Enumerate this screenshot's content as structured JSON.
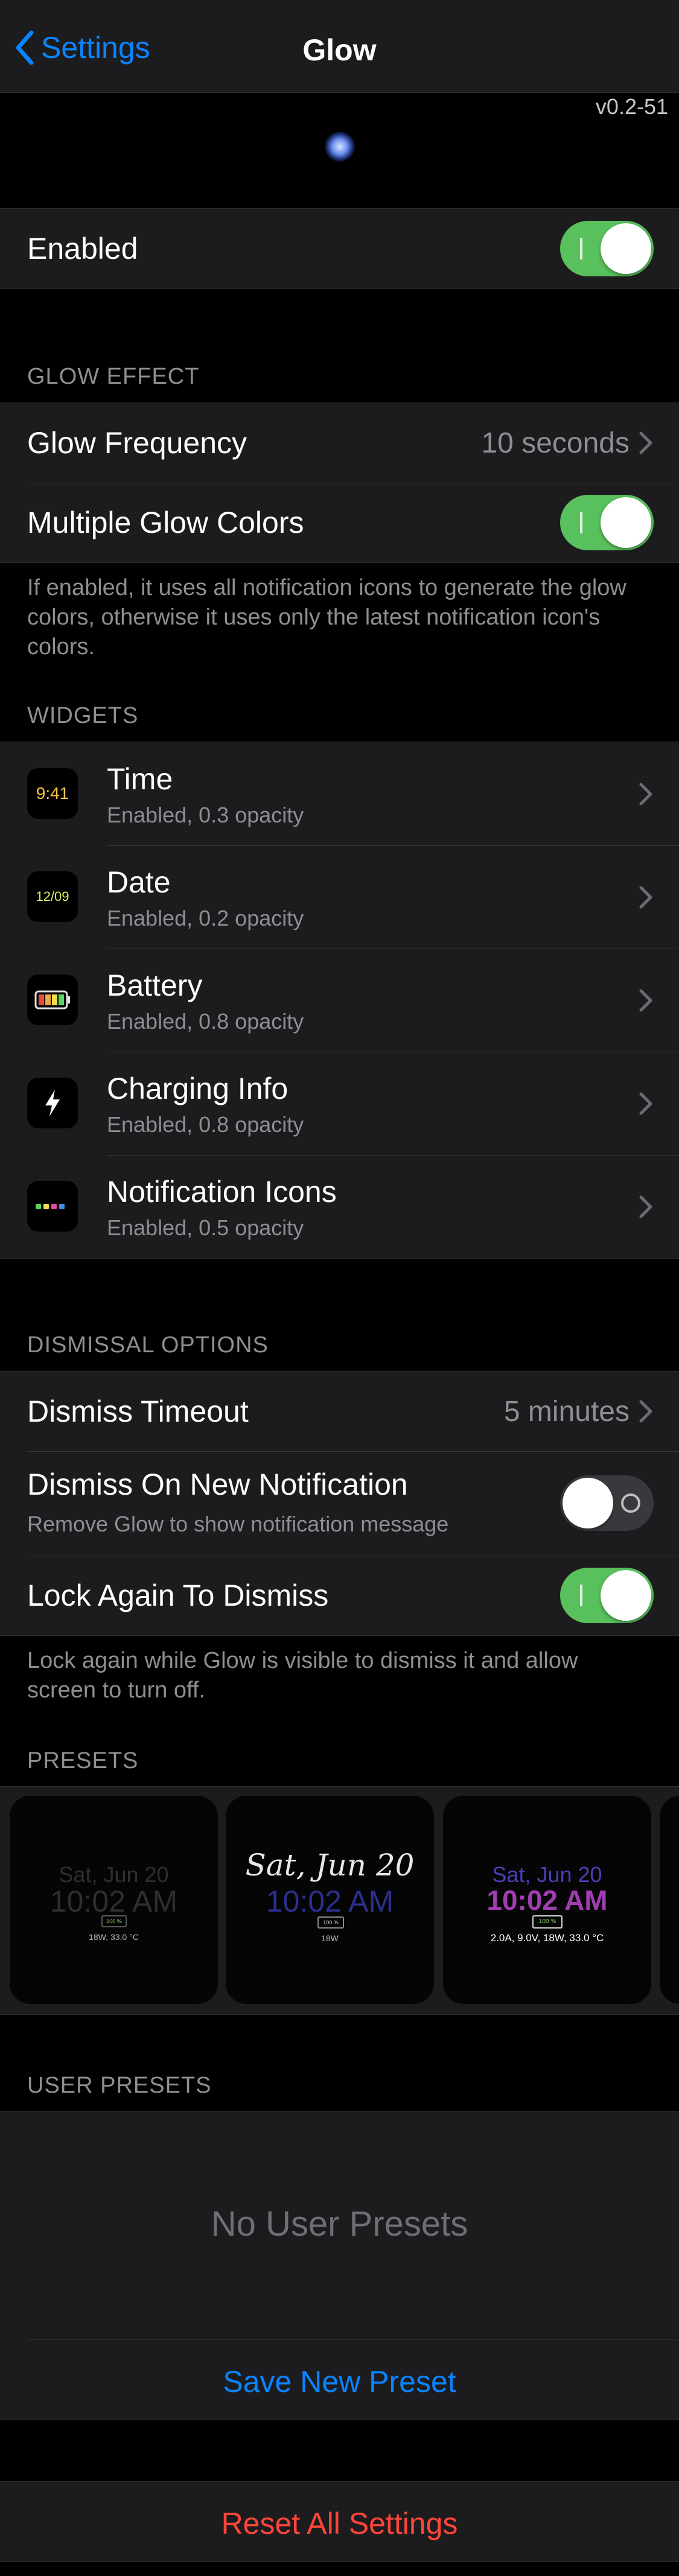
{
  "nav": {
    "back_label": "Settings",
    "title": "Glow"
  },
  "version": "v0.2-51",
  "enabled": {
    "label": "Enabled",
    "on": true
  },
  "glow_effect": {
    "header": "GLOW EFFECT",
    "frequency_label": "Glow Frequency",
    "frequency_value": "10 seconds",
    "multiple_colors_label": "Multiple Glow Colors",
    "multiple_colors_on": true,
    "footer": "If enabled, it uses all notification icons to generate the glow colors, otherwise it uses only the latest notification icon's colors."
  },
  "widgets": {
    "header": "WIDGETS",
    "items": [
      {
        "icon": "time-icon",
        "icon_text": "9:41",
        "title": "Time",
        "subtitle": "Enabled, 0.3 opacity"
      },
      {
        "icon": "date-icon",
        "icon_text": "12/09",
        "title": "Date",
        "subtitle": "Enabled, 0.2 opacity"
      },
      {
        "icon": "battery-icon",
        "icon_text": "",
        "title": "Battery",
        "subtitle": "Enabled, 0.8 opacity"
      },
      {
        "icon": "lightning-icon",
        "icon_text": "",
        "title": "Charging Info",
        "subtitle": "Enabled, 0.8 opacity"
      },
      {
        "icon": "notification-dots-icon",
        "icon_text": "",
        "title": "Notification Icons",
        "subtitle": "Enabled, 0.5 opacity"
      }
    ]
  },
  "dismissal": {
    "header": "DISMISSAL OPTIONS",
    "timeout_label": "Dismiss Timeout",
    "timeout_value": "5 minutes",
    "new_notification_label": "Dismiss On New Notification",
    "new_notification_sub": "Remove Glow to show notification message",
    "new_notification_on": false,
    "lock_again_label": "Lock Again To Dismiss",
    "lock_again_on": true,
    "footer": "Lock again while Glow is visible to dismiss it and allow screen to turn off."
  },
  "presets": {
    "header": "PRESETS",
    "items": [
      {
        "date": "Sat, Jun 20",
        "time": "10:02 AM",
        "battery": "100 %",
        "info": "18W, 33.0 °C"
      },
      {
        "date": "Sat, Jun 20",
        "time": "10:02 AM",
        "battery": "100 %",
        "info": "18W"
      },
      {
        "date": "Sat, Jun 20",
        "time": "10:02 AM",
        "battery": "100 %",
        "info": "2.0A, 9.0V, 18W, 33.0 °C"
      }
    ]
  },
  "user_presets": {
    "header": "USER PRESETS",
    "empty_text": "No User Presets",
    "save_label": "Save New Preset"
  },
  "reset_label": "Reset All Settings",
  "colors": {
    "accent_blue": "#0a84ff",
    "toggle_green": "#58c05c",
    "destructive_red": "#ff453a",
    "cell_bg": "#1c1c1e"
  }
}
